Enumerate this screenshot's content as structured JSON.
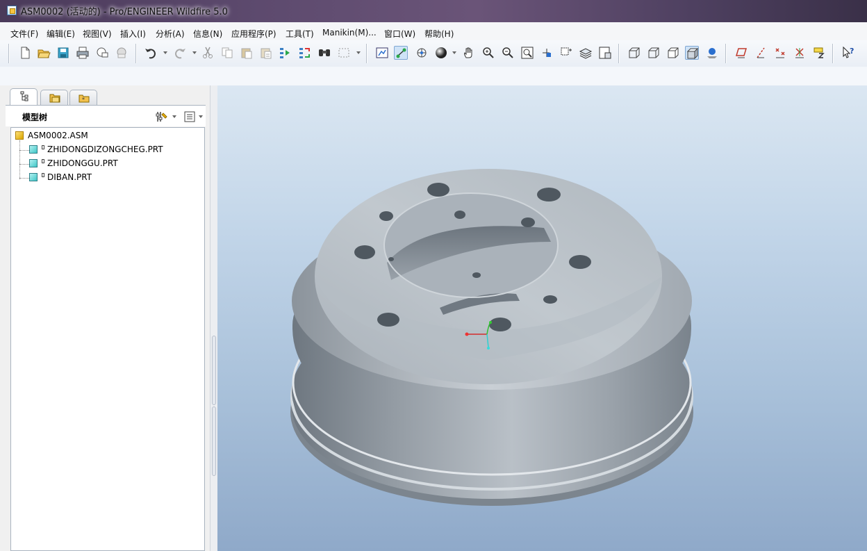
{
  "window": {
    "title": "ASM0002 (活动的) - Pro/ENGINEER Wildfire 5.0"
  },
  "menu": [
    "文件(F)",
    "编辑(E)",
    "视图(V)",
    "插入(I)",
    "分析(A)",
    "信息(N)",
    "应用程序(P)",
    "工具(T)",
    "Manikin(M)...",
    "窗口(W)",
    "帮助(H)"
  ],
  "toolbar": {
    "icons": [
      "new-file",
      "open",
      "save",
      "print",
      "send-email",
      "close-window",
      "undo",
      "redo",
      "cut",
      "copy",
      "paste",
      "paste-special",
      "regenerate",
      "regenerate-manager",
      "find",
      "select-box",
      "orient",
      "datum-display",
      "spin-center",
      "shading",
      "pan",
      "zoom-in",
      "zoom-out",
      "refit",
      "reorient",
      "saved-views",
      "layers",
      "view-manager",
      "wireframe",
      "hidden-line",
      "no-hidden",
      "shaded",
      "enhanced-realism",
      "datum-planes",
      "datum-axes",
      "datum-points",
      "csys",
      "annotation",
      "context-help"
    ],
    "active_icons": [
      "datum-display",
      "shaded"
    ]
  },
  "left_panel": {
    "tabs": [
      "model-tree-tab",
      "folder-browser-tab",
      "favorites-tab"
    ],
    "header_label": "模型树",
    "tree": {
      "root": "ASM0002.ASM",
      "children": [
        "ZHIDONGDIZONGCHEG.PRT",
        "ZHIDONGGU.PRT",
        "DIBAN.PRT"
      ]
    }
  },
  "viewport": {
    "model": "brake-drum-assembly",
    "colors": {
      "background_top": "#dbe7f2",
      "background_bottom": "#8fa9c9",
      "model": "#a9b1b9"
    }
  }
}
